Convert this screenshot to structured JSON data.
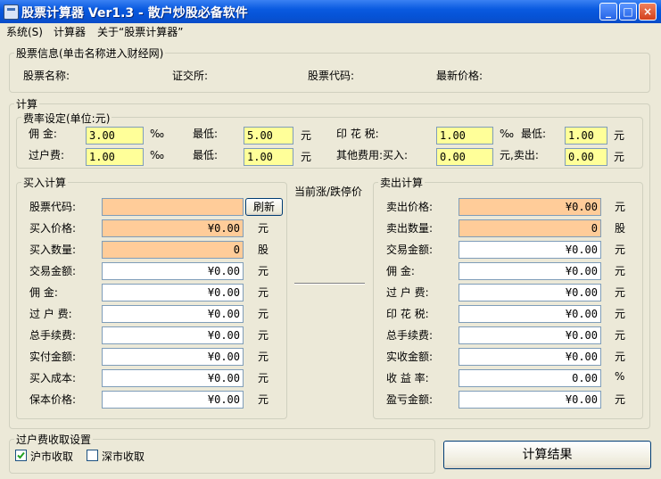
{
  "window": {
    "title": "股票计算器 Ver1.3 - 散户炒股必备软件",
    "minimize": "_",
    "maximize": "□",
    "close": "×"
  },
  "menu": {
    "items": [
      "系统(S)",
      "计算器",
      "关于“股票计算器”"
    ]
  },
  "stock_info": {
    "group_title": "股票信息(单击名称进入财经网)",
    "name_label": "股票名称:",
    "exchange_label": "证交所:",
    "code_label": "股票代码:",
    "price_label": "最新价格:"
  },
  "calc": {
    "group_title": "计算",
    "fee": {
      "group_title": "费率设定(单位:元)",
      "commission_label": "佣  金:",
      "commission_value": "3.00",
      "commission_unit": "‰",
      "commission_min_label": "最低:",
      "commission_min_value": "5.00",
      "commission_min_unit": "元",
      "stamp_label": "印 花 税:",
      "stamp_value": "1.00",
      "stamp_unit": "‰",
      "stamp_min_label": "最低:",
      "stamp_min_value": "1.00",
      "stamp_min_unit": "元",
      "transfer_label": "过户费:",
      "transfer_value": "1.00",
      "transfer_unit": "‰",
      "transfer_min_label": "最低:",
      "transfer_min_value": "1.00",
      "transfer_min_unit": "元",
      "other_buy_label": "其他费用:买入:",
      "other_buy_value": "0.00",
      "other_sell_label": "元,卖出:",
      "other_sell_value": "0.00",
      "other_sell_unit": "元"
    },
    "buy": {
      "group_title": "买入计算",
      "refresh_button": "刷新",
      "rows": [
        {
          "label": "股票代码:",
          "value": "",
          "unit": ""
        },
        {
          "label": "买入价格:",
          "value": "¥0.00",
          "unit": "元"
        },
        {
          "label": "买入数量:",
          "value": "0",
          "unit": "股"
        },
        {
          "label": "交易金额:",
          "value": "¥0.00",
          "unit": "元"
        },
        {
          "label": "佣    金:",
          "value": "¥0.00",
          "unit": "元"
        },
        {
          "label": "过 户 费:",
          "value": "¥0.00",
          "unit": "元"
        },
        {
          "label": "总手续费:",
          "value": "¥0.00",
          "unit": "元"
        },
        {
          "label": "实付金额:",
          "value": "¥0.00",
          "unit": "元"
        },
        {
          "label": "买入成本:",
          "value": "¥0.00",
          "unit": "元"
        },
        {
          "label": "保本价格:",
          "value": "¥0.00",
          "unit": "元"
        }
      ]
    },
    "limit_label": "当前涨/跌停价",
    "sell": {
      "group_title": "卖出计算",
      "rows": [
        {
          "label": "卖出价格:",
          "value": "¥0.00",
          "unit": "元"
        },
        {
          "label": "卖出数量:",
          "value": "0",
          "unit": "股"
        },
        {
          "label": "交易金额:",
          "value": "¥0.00",
          "unit": "元"
        },
        {
          "label": "佣    金:",
          "value": "¥0.00",
          "unit": "元"
        },
        {
          "label": "过 户 费:",
          "value": "¥0.00",
          "unit": "元"
        },
        {
          "label": "印 花 税:",
          "value": "¥0.00",
          "unit": "元"
        },
        {
          "label": "总手续费:",
          "value": "¥0.00",
          "unit": "元"
        },
        {
          "label": "实收金额:",
          "value": "¥0.00",
          "unit": "元"
        },
        {
          "label": "收 益 率:",
          "value": "0.00",
          "unit": "%"
        },
        {
          "label": "盈亏金额:",
          "value": "¥0.00",
          "unit": "元"
        }
      ]
    }
  },
  "transfer_setting": {
    "group_title": "过户费收取设置",
    "sh_label": "沪市收取",
    "sz_label": "深市收取",
    "sh_checked": true,
    "sz_checked": false
  },
  "calc_button": "计算结果",
  "colors": {
    "input_yellow": "#ffff99",
    "input_orange": "#ffcc99",
    "titlebar": "#0a5ae0"
  }
}
